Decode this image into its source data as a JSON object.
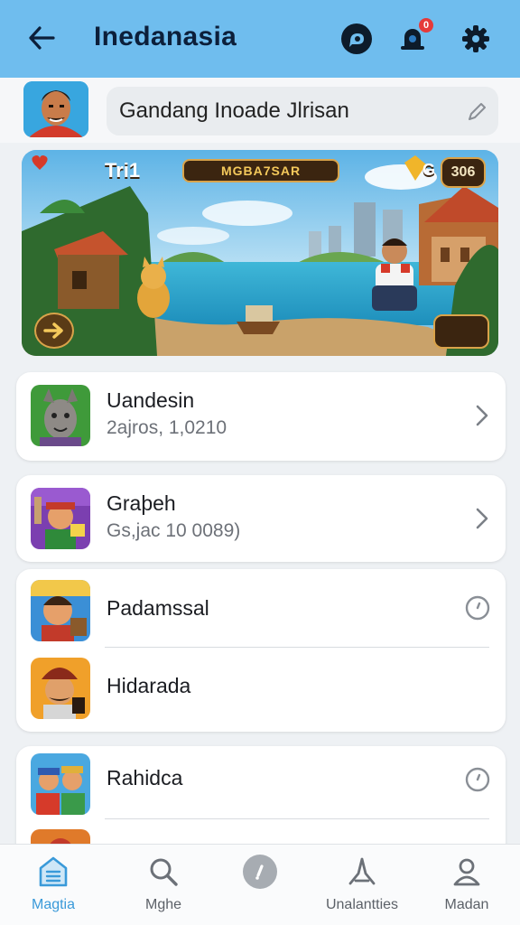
{
  "header": {
    "title": "Inedanasia",
    "notification_count": "0",
    "colors": {
      "bar": "#6fbdee",
      "title": "#0c1f3a"
    }
  },
  "profile": {
    "name_value": "Gandang Inoade Jlrisan",
    "avatar_icon": "player-avatar-icon"
  },
  "banner": {
    "level_label": "Tri1",
    "title": "MGBA7SAR",
    "gem_label": "G",
    "coins": "306"
  },
  "list": [
    {
      "title": "Uandesin",
      "subtitle": "2ajros, 1,0210",
      "icon": "game-character-icon",
      "action": "chevron-right-icon"
    },
    {
      "title": "Graþeh",
      "subtitle": "Gs,jac 10 0089)",
      "icon": "builder-character-icon",
      "action": "chevron-right-icon"
    },
    {
      "title": "Padamssal",
      "icon": "character-portrait-icon",
      "action": "circle-button-icon"
    },
    {
      "title": "Hidarada",
      "icon": "pirate-character-icon"
    },
    {
      "title": "Rahidca",
      "icon": "duo-characters-icon",
      "action": "circle-button-icon"
    }
  ],
  "nav": [
    {
      "label": "Magtia",
      "icon": "home-icon",
      "active": true
    },
    {
      "label": "Mghe",
      "icon": "search-icon"
    },
    {
      "label": "",
      "icon": "center-circle-icon"
    },
    {
      "label": "Unalantties",
      "icon": "people-icon"
    },
    {
      "label": "Madan",
      "icon": "profile-icon"
    }
  ],
  "accent": "#3a9ad9"
}
